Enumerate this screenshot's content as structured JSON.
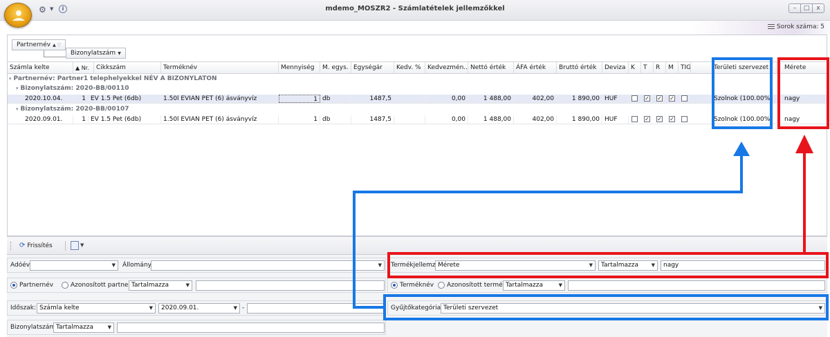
{
  "window": {
    "title": "mdemo_MOSZR2 - Számlatételek jellemzőkkel",
    "controls": [
      "–",
      "□",
      "x"
    ]
  },
  "toolbar_top": {
    "row_count_label": "Sorok száma: 5"
  },
  "groupbar": {
    "chip1": "Partnernév",
    "chip1_sort": "▲",
    "chip2": "Bizonylatszám",
    "chip2_sort": "▼"
  },
  "columns": [
    "Számla kelte",
    "▲ Nr.",
    "Cikkszám",
    "Terméknév",
    "Mennyiség",
    "M. egys.",
    "Egységár",
    "Kedv. %",
    "Kedvezmén...",
    "Nettó érték",
    "ÁFA érték",
    "Bruttó érték",
    "Deviza",
    "K",
    "T",
    "R",
    "M",
    "TIG",
    "Területi szervezet",
    "Mérete"
  ],
  "groups": {
    "partner": "Partnernév: Partner1 telephelyekkel NÉV A BIZONYLATON",
    "doc1": "Bizonylatszám: 2020-BB/00110",
    "doc2": "Bizonylatszám: 2020-BB/00107"
  },
  "rows": [
    {
      "date": "2020.10.04.",
      "nr": "1",
      "sku": "EV 1.5 Pet (6db)",
      "product": "1.50l EVIAN PET (6) ásványvíz",
      "qty": "1",
      "unit": "db",
      "price": "1487,5",
      "discount": "0,00",
      "net": "1 488,00",
      "vat": "402,00",
      "gross": "1 890,00",
      "currency": "HUF",
      "k": false,
      "t": true,
      "r": true,
      "m": true,
      "tig": false,
      "region": "Szolnok (100.00%)",
      "size": "nagy"
    },
    {
      "date": "2020.09.01.",
      "nr": "1",
      "sku": "EV 1.5 Pet (6db)",
      "product": "1.50l EVIAN PET (6) ásványvíz",
      "qty": "1",
      "unit": "db",
      "price": "1487,5",
      "discount": "0,00",
      "net": "1 488,00",
      "vat": "402,00",
      "gross": "1 890,00",
      "currency": "HUF",
      "k": false,
      "t": true,
      "r": true,
      "m": true,
      "tig": false,
      "region": "Szolnok (100.00%)",
      "size": "nagy"
    }
  ],
  "bottom_toolbar": {
    "refresh": "Frissítés"
  },
  "filters": {
    "ado_label": "Adóév:",
    "allomany_label": "Állomány:",
    "partner_radio": "Partnernév",
    "azon_partner_radio": "Azonosított partner",
    "contains1": "Tartalmazza",
    "idoszak_label": "Időszak:",
    "idoszak_value": "Számla kelte",
    "date_from": "2020.09.01.",
    "date_sep": "-",
    "bizonylat_label": "Bizonylatszám:",
    "contains2": "Tartalmazza",
    "termekjellemzo_label": "Termékjellemző:",
    "termekjellemzo_value": "Mérete",
    "contains3": "Tartalmazza",
    "termekjellemzo_text": "nagy",
    "termeknev_radio": "Terméknév",
    "azon_termek_radio": "Azonosított termék",
    "contains4": "Tartalmazza",
    "gyujto_label": "Gyűjtőkategória:",
    "gyujto_value": "Területi szervezet"
  },
  "colors": {
    "highlight_red": "#e8141b",
    "highlight_blue": "#1778e6",
    "selection": "#e5e9f5"
  }
}
